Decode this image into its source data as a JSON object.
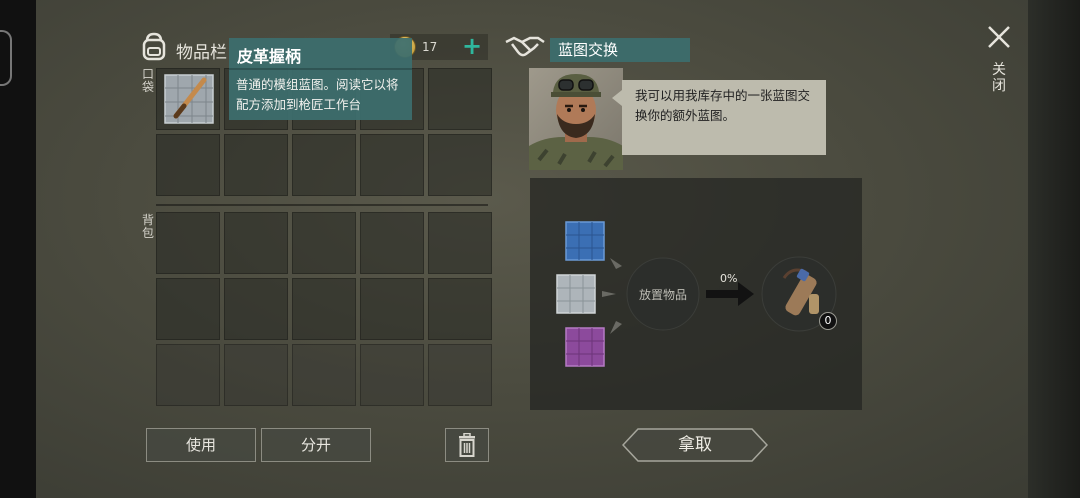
{
  "colors": {
    "accent_teal": "#3c6e6e",
    "add_green": "#2fb79d",
    "background": "#4b4b3f"
  },
  "inventory": {
    "title": "物品栏",
    "coin_count": "17",
    "add_icon": "+",
    "pocket_label": "口袋",
    "backpack_label": "背包",
    "pocket_rows": 2,
    "backpack_rows": 3,
    "columns": 5
  },
  "tooltip": {
    "title": "皮革握柄",
    "description": "普通的模组蓝图。阅读它以将配方添加到枪匠工作台"
  },
  "buttons": {
    "use": "使用",
    "split": "分开",
    "take": "拿取"
  },
  "exchange": {
    "title": "蓝图交换",
    "npc_dialog": "我可以用我库存中的一张蓝图交换你的额外蓝图。",
    "place_item": "放置物品",
    "progress": "0%",
    "result_count": "0",
    "blueprint_inputs": [
      "blue",
      "gray",
      "purple"
    ]
  },
  "close": {
    "label": "关闭"
  },
  "icons": {
    "backpack": "backpack-icon",
    "coin": "coin-icon",
    "handshake": "handshake-icon",
    "close": "close-icon",
    "trash": "trash-icon"
  }
}
